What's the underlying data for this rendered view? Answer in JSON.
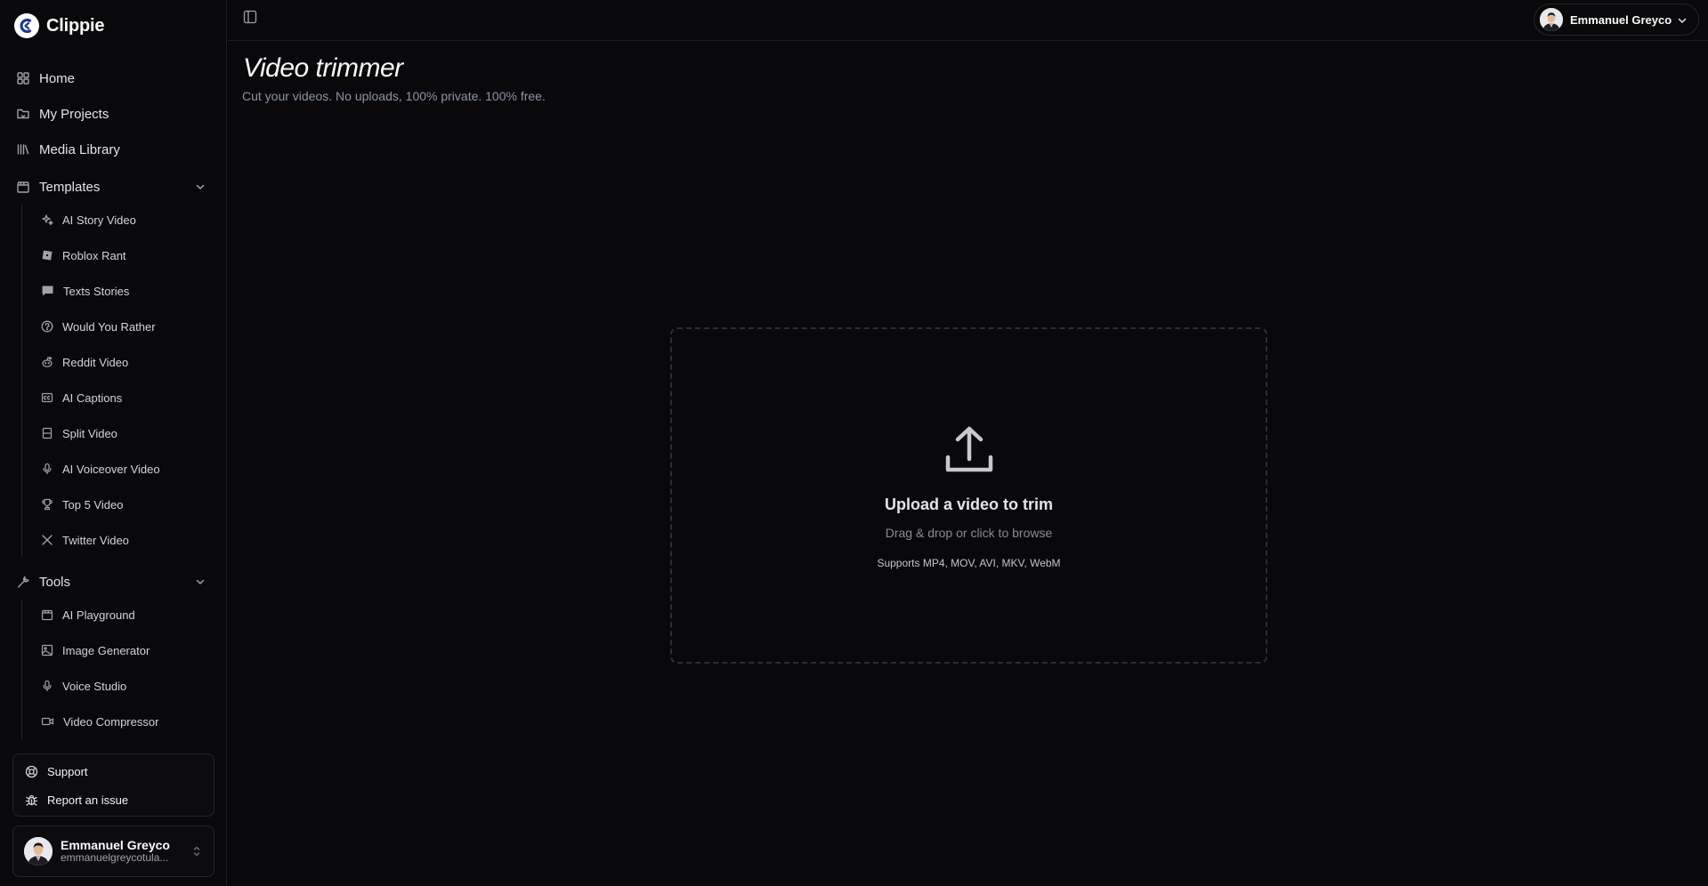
{
  "app": {
    "name": "Clippie"
  },
  "sidebar": {
    "nav": [
      {
        "label": "Home",
        "icon": "grid-icon"
      },
      {
        "label": "My Projects",
        "icon": "folder-icon"
      },
      {
        "label": "Media Library",
        "icon": "library-icon"
      }
    ],
    "templates": {
      "label": "Templates",
      "items": [
        {
          "label": "AI Story Video",
          "icon": "sparkles-icon"
        },
        {
          "label": "Roblox Rant",
          "icon": "roblox-icon"
        },
        {
          "label": "Texts Stories",
          "icon": "message-icon"
        },
        {
          "label": "Would You Rather",
          "icon": "question-icon"
        },
        {
          "label": "Reddit Video",
          "icon": "reddit-icon"
        },
        {
          "label": "AI Captions",
          "icon": "captions-icon"
        },
        {
          "label": "Split Video",
          "icon": "split-icon"
        },
        {
          "label": "AI Voiceover Video",
          "icon": "mic-icon"
        },
        {
          "label": "Top 5 Video",
          "icon": "trophy-icon"
        },
        {
          "label": "Twitter Video",
          "icon": "x-logo-icon"
        }
      ]
    },
    "tools": {
      "label": "Tools",
      "items": [
        {
          "label": "AI Playground",
          "icon": "clapper-icon"
        },
        {
          "label": "Image Generator",
          "icon": "image-icon"
        },
        {
          "label": "Voice Studio",
          "icon": "mic-icon"
        },
        {
          "label": "Video Compressor",
          "icon": "video-icon"
        }
      ]
    },
    "help": {
      "support": "Support",
      "report": "Report an issue"
    },
    "user": {
      "name": "Emmanuel Greyco",
      "email": "emmanuelgreycotula..."
    }
  },
  "topbar": {
    "user_name": "Emmanuel Greyco"
  },
  "main": {
    "title": "Video trimmer",
    "subtitle": "Cut your videos. No uploads, 100% private. 100% free.",
    "dropzone": {
      "title": "Upload a video to trim",
      "subtitle": "Drag & drop or click to browse",
      "formats": "Supports MP4, MOV, AVI, MKV, WebM"
    }
  },
  "colors": {
    "background": "#09090b",
    "border": "#27272a",
    "text": "#e4e4e7",
    "muted": "#8b95a7"
  }
}
